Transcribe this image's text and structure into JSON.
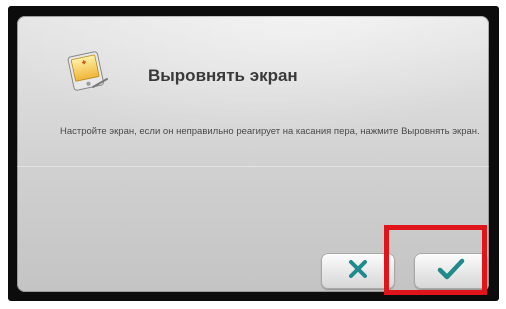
{
  "dialog": {
    "title": "Выровнять экран",
    "description": "Настройте экран, если он неправильно реагирует на касания пера, нажмите Выровнять экран."
  },
  "icons": {
    "app": "screen-align-icon",
    "cancel": "cross-icon",
    "ok": "checkmark-icon"
  },
  "colors": {
    "accent_teal": "#1f8a8c",
    "highlight_red": "#e0151b",
    "title_text": "#3a3a3a"
  }
}
